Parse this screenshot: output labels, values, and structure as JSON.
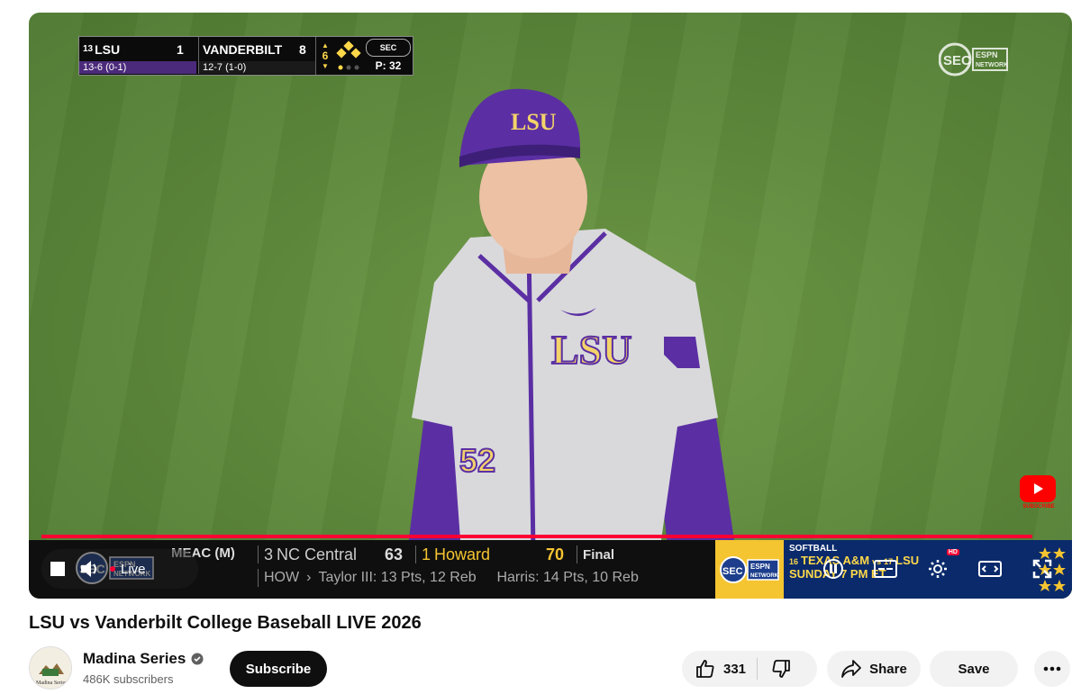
{
  "scorebug": {
    "lsu_rank": "13",
    "lsu_name": "LSU",
    "lsu_score": "1",
    "lsu_record": "13-6 (0-1)",
    "van_name": "VANDERBILT",
    "van_score": "8",
    "van_record": "12-7 (1-0)",
    "inning": "6",
    "pitch_count": "P: 32"
  },
  "ticker": {
    "conference": "MEAC (M)",
    "team1_rank": "3",
    "team1_name": "NC Central",
    "team1_score": "63",
    "team2_rank": "1",
    "team2_name": "Howard",
    "team2_score": "70",
    "status": "Final",
    "abbr": "HOW",
    "player1": "Taylor III: 13 Pts, 12 Reb",
    "player2": "Harris: 14 Pts, 10 Reb",
    "promo_sport": "SOFTBALL",
    "promo_matchup_rank1": "16",
    "promo_matchup_team1": "TEXAS A&M",
    "promo_vs": "vs",
    "promo_matchup_rank2": "17",
    "promo_matchup_team2": "LSU",
    "promo_time": "SUNDAY 7 PM ET"
  },
  "controls": {
    "live_label": "Live",
    "hd_label": "HD"
  },
  "video": {
    "title": "LSU vs Vanderbilt College Baseball LIVE 2026"
  },
  "channel": {
    "name": "Madina Series",
    "subscribers": "486K subscribers",
    "subscribe_label": "Subscribe"
  },
  "actions": {
    "like_count": "331",
    "share_label": "Share",
    "save_label": "Save"
  },
  "colors": {
    "lsu_purple": "#4b2a7b",
    "live_red": "#ff0033",
    "field_green": "#5f8a3c"
  }
}
